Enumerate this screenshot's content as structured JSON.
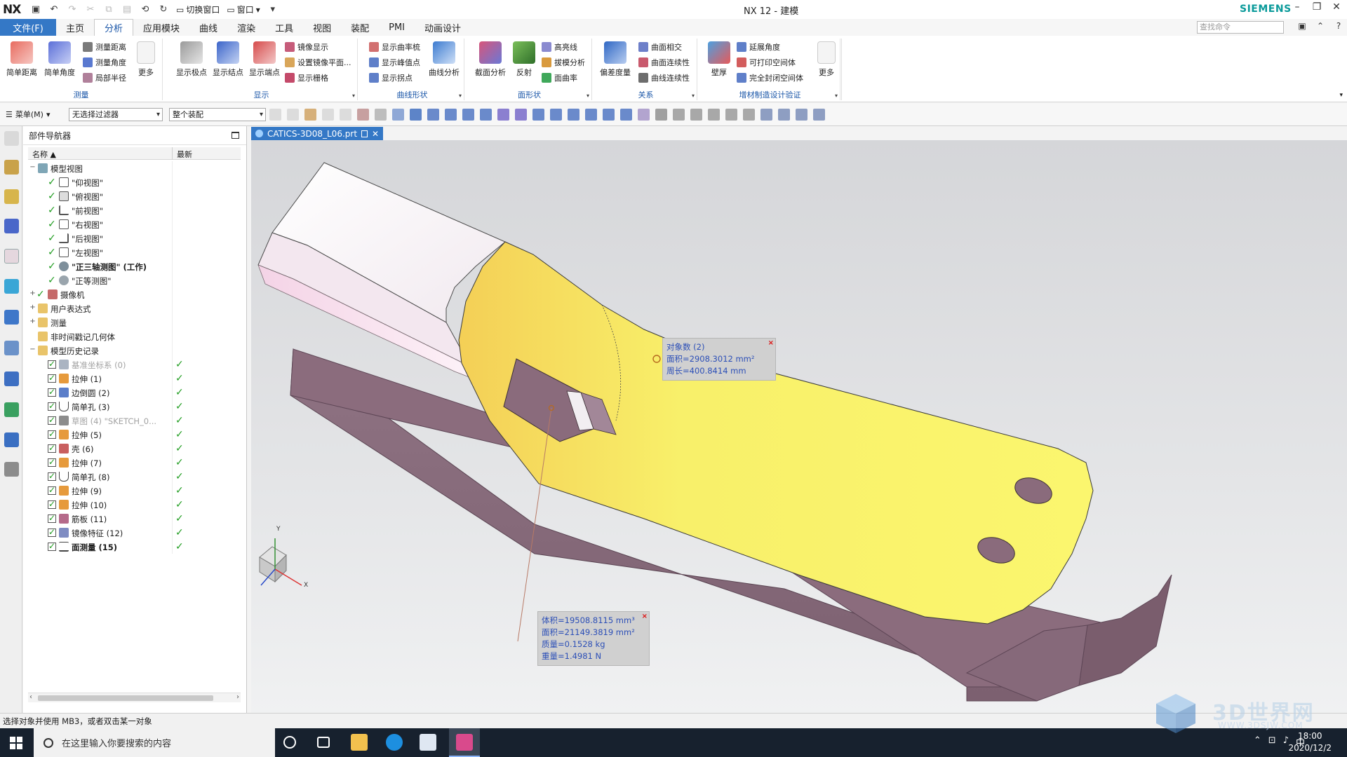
{
  "titlebar": {
    "logo": "NX",
    "switch_window": "切换窗口",
    "window_menu": "窗口",
    "app_title": "NX 12 - 建模",
    "brand": "SIEMENS"
  },
  "tabs": {
    "file": "文件(F)",
    "items": [
      "主页",
      "分析",
      "应用模块",
      "曲线",
      "渲染",
      "工具",
      "视图",
      "装配",
      "PMI",
      "动画设计"
    ],
    "active": "分析",
    "command_search_placeholder": "查找命令"
  },
  "ribbon": {
    "measure": {
      "label": "测量",
      "big": [
        "简单距离",
        "简单角度"
      ],
      "small": [
        "测量距离",
        "测量角度",
        "局部半径"
      ],
      "more": "更多"
    },
    "display": {
      "label": "显示",
      "big": [
        "显示极点",
        "显示结点",
        "显示端点"
      ],
      "small": [
        "镜像显示",
        "设置镜像平面...",
        "显示栅格"
      ]
    },
    "curve_shape": {
      "label": "曲线形状",
      "small": [
        "显示曲率梳",
        "显示峰值点",
        "显示拐点"
      ],
      "big": [
        "曲线分析"
      ]
    },
    "face_shape": {
      "label": "面形状",
      "big": [
        "截面分析",
        "反射"
      ],
      "small": [
        "高亮线",
        "拔模分析",
        "面曲率"
      ]
    },
    "relation": {
      "label": "关系",
      "big": [
        "偏差度量"
      ],
      "small": [
        "曲面相交",
        "曲面连续性",
        "曲线连续性"
      ]
    },
    "additive": {
      "label": "增材制造设计验证",
      "big": [
        "壁厚"
      ],
      "small": [
        "延展角度",
        "可打印空间体",
        "完全封闭空间体"
      ],
      "more": "更多"
    }
  },
  "selbar": {
    "menu": "菜单(M)",
    "filter": "无选择过滤器",
    "scope": "整个装配"
  },
  "navigator": {
    "title": "部件导航器",
    "col_name": "名称",
    "col_latest": "最新",
    "model_views": {
      "label": "模型视图",
      "items": [
        "\"仰视图\"",
        "\"俯视图\"",
        "\"前视图\"",
        "\"右视图\"",
        "\"后视图\"",
        "\"左视图\"",
        "\"正三轴测图\" (工作)",
        "\"正等测图\""
      ]
    },
    "folders": [
      "摄像机",
      "用户表达式",
      "测量",
      "非时间戳记几何体",
      "模型历史记录"
    ],
    "history": [
      {
        "label": "基准坐标系 (0)",
        "gray": true
      },
      {
        "label": "拉伸 (1)"
      },
      {
        "label": "边倒圆 (2)"
      },
      {
        "label": "简单孔 (3)"
      },
      {
        "label": "草图 (4) \"SKETCH_0...",
        "gray": true
      },
      {
        "label": "拉伸 (5)"
      },
      {
        "label": "壳 (6)"
      },
      {
        "label": "拉伸 (7)"
      },
      {
        "label": "简单孔 (8)"
      },
      {
        "label": "拉伸 (9)"
      },
      {
        "label": "拉伸 (10)"
      },
      {
        "label": "筋板 (11)"
      },
      {
        "label": "镜像特征 (12)"
      },
      {
        "label": "面测量 (15)",
        "bold": true
      }
    ]
  },
  "document": {
    "tab": "CATICS-3D08_L06.prt"
  },
  "callouts": {
    "face": [
      "对象数 (2)",
      "面积=2908.3012 mm²",
      "周长=400.8414 mm"
    ],
    "body": [
      "体积=19508.8115 mm³",
      "面积=21149.3819 mm²",
      "质量=0.1528 kg",
      "重量=1.4981 N"
    ]
  },
  "triad": {
    "x": "X",
    "y": "Y"
  },
  "status": "选择对象并使用 MB3，或者双击某一对象",
  "taskbar": {
    "search_placeholder": "在这里输入你要搜索的内容",
    "time": "18:00",
    "date": "2020/12/2",
    "ime": "中"
  },
  "watermark": {
    "text": "3D世界网",
    "url": "WWW.3DSJW.COM"
  },
  "colors": {
    "accent": "#3478c6",
    "face_yellow": "#f5f26a",
    "body_mauve": "#8a6a7a",
    "measure_text": "#2c4fb7"
  }
}
